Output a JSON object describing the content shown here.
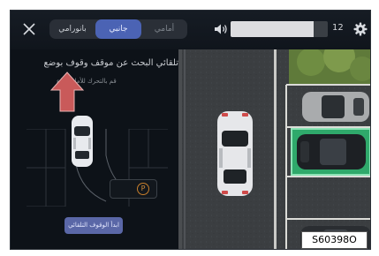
{
  "header": {
    "tabs": [
      {
        "label": "بانورامي",
        "state": "normal"
      },
      {
        "label": "جانبي",
        "state": "selected"
      },
      {
        "label": "أمامي",
        "state": "dimmed"
      }
    ],
    "volume_level": 0.85,
    "volume_value": "12",
    "icons": [
      "close-icon",
      "speaker-icon",
      "gear-icon"
    ]
  },
  "left_panel": {
    "instruction": "تلقائي البحث عن موقف وقوف بوضع",
    "hint": "قم بالتحرك للأمام ببطء",
    "gear_indicator": "P",
    "action_button": "ابدأ الوقوف التلقائي"
  },
  "image_label": "S60398O",
  "colors": {
    "accent": "#4b63b4",
    "slot_highlight": "#2fa96b",
    "arrow": "#c95a5a",
    "gear": "#d08a38"
  }
}
